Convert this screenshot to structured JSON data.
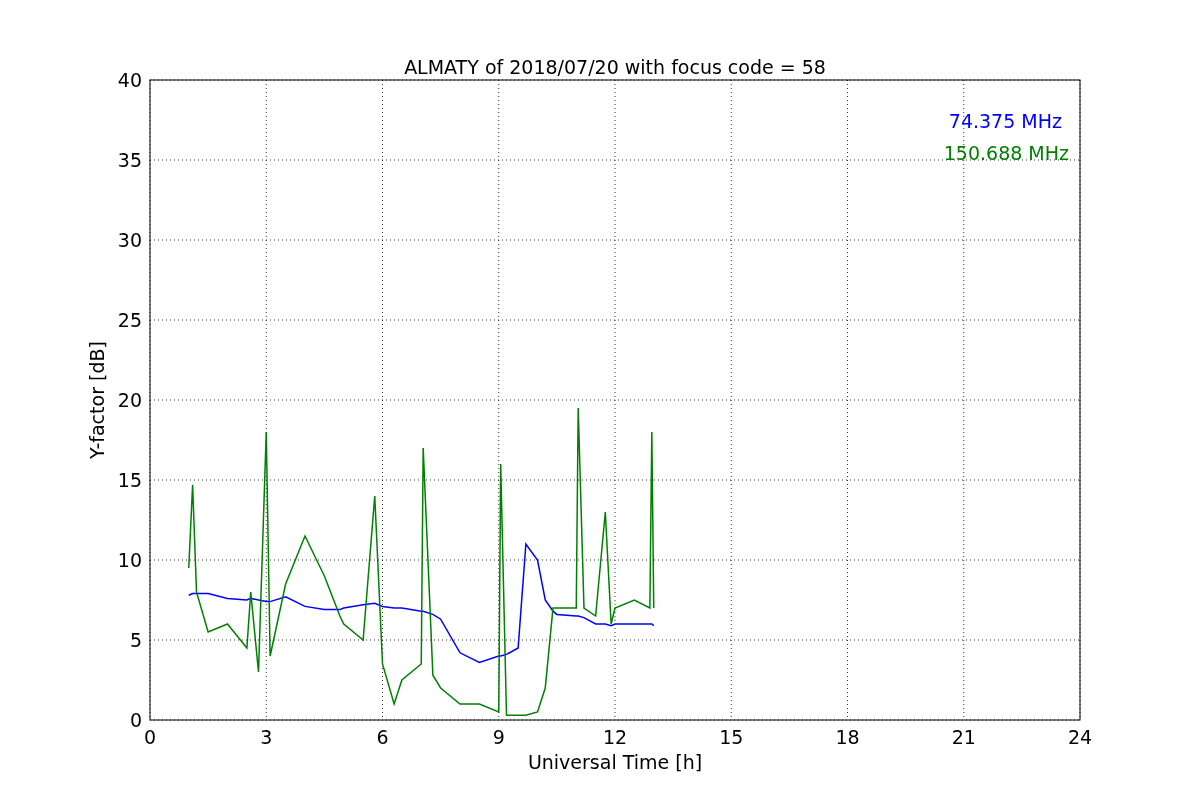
{
  "figure": {
    "chart_data": {
      "type": "line",
      "title": "ALMATY of 2018/07/20 with focus code = 58",
      "xlabel": "Universal Time [h]",
      "ylabel": "Y-factor [dB]",
      "x": [
        1.0,
        1.1,
        1.2,
        1.5,
        2.0,
        2.5,
        2.6,
        2.8,
        3.0,
        3.1,
        3.5,
        4.0,
        4.5,
        4.9,
        5.0,
        5.5,
        5.8,
        6.0,
        6.3,
        6.5,
        7.0,
        7.05,
        7.3,
        7.5,
        8.0,
        8.5,
        9.0,
        9.05,
        9.2,
        9.5,
        9.7,
        10.0,
        10.2,
        10.4,
        10.5,
        11.0,
        11.05,
        11.2,
        11.5,
        11.75,
        11.9,
        12.0,
        12.5,
        12.9,
        12.95,
        13.0
      ],
      "series": [
        {
          "name": "74.375 MHz",
          "color": "#0000ff",
          "values": [
            7.8,
            7.9,
            7.9,
            7.9,
            7.6,
            7.5,
            7.6,
            7.5,
            7.4,
            7.4,
            7.7,
            7.1,
            6.9,
            6.9,
            7.0,
            7.2,
            7.3,
            7.1,
            7.0,
            7.0,
            6.8,
            6.8,
            6.6,
            6.3,
            4.2,
            3.6,
            4.0,
            4.0,
            4.1,
            4.5,
            11.0,
            10.0,
            7.5,
            6.8,
            6.6,
            6.5,
            6.5,
            6.4,
            6.0,
            6.0,
            5.9,
            6.0,
            6.0,
            6.0,
            6.0,
            5.9
          ]
        },
        {
          "name": "150.688 MHz",
          "color": "#008000",
          "values": [
            9.5,
            14.7,
            8.0,
            5.5,
            6.0,
            4.5,
            8.0,
            3.0,
            18.0,
            4.0,
            8.5,
            11.5,
            9.0,
            6.5,
            6.0,
            5.0,
            14.0,
            3.5,
            1.0,
            2.5,
            3.5,
            17.0,
            2.8,
            2.0,
            1.0,
            1.0,
            0.5,
            16.0,
            0.3,
            0.3,
            0.3,
            0.5,
            2.0,
            7.0,
            7.0,
            7.0,
            19.5,
            7.0,
            6.5,
            13.0,
            6.0,
            7.0,
            7.5,
            7.0,
            18.0,
            7.0
          ]
        }
      ],
      "xlim": [
        0,
        24
      ],
      "ylim": [
        0,
        40
      ],
      "xticks": [
        0,
        3,
        6,
        9,
        12,
        15,
        18,
        21,
        24
      ],
      "yticks": [
        0,
        5,
        10,
        15,
        20,
        25,
        30,
        35,
        40
      ],
      "grid": true
    }
  }
}
